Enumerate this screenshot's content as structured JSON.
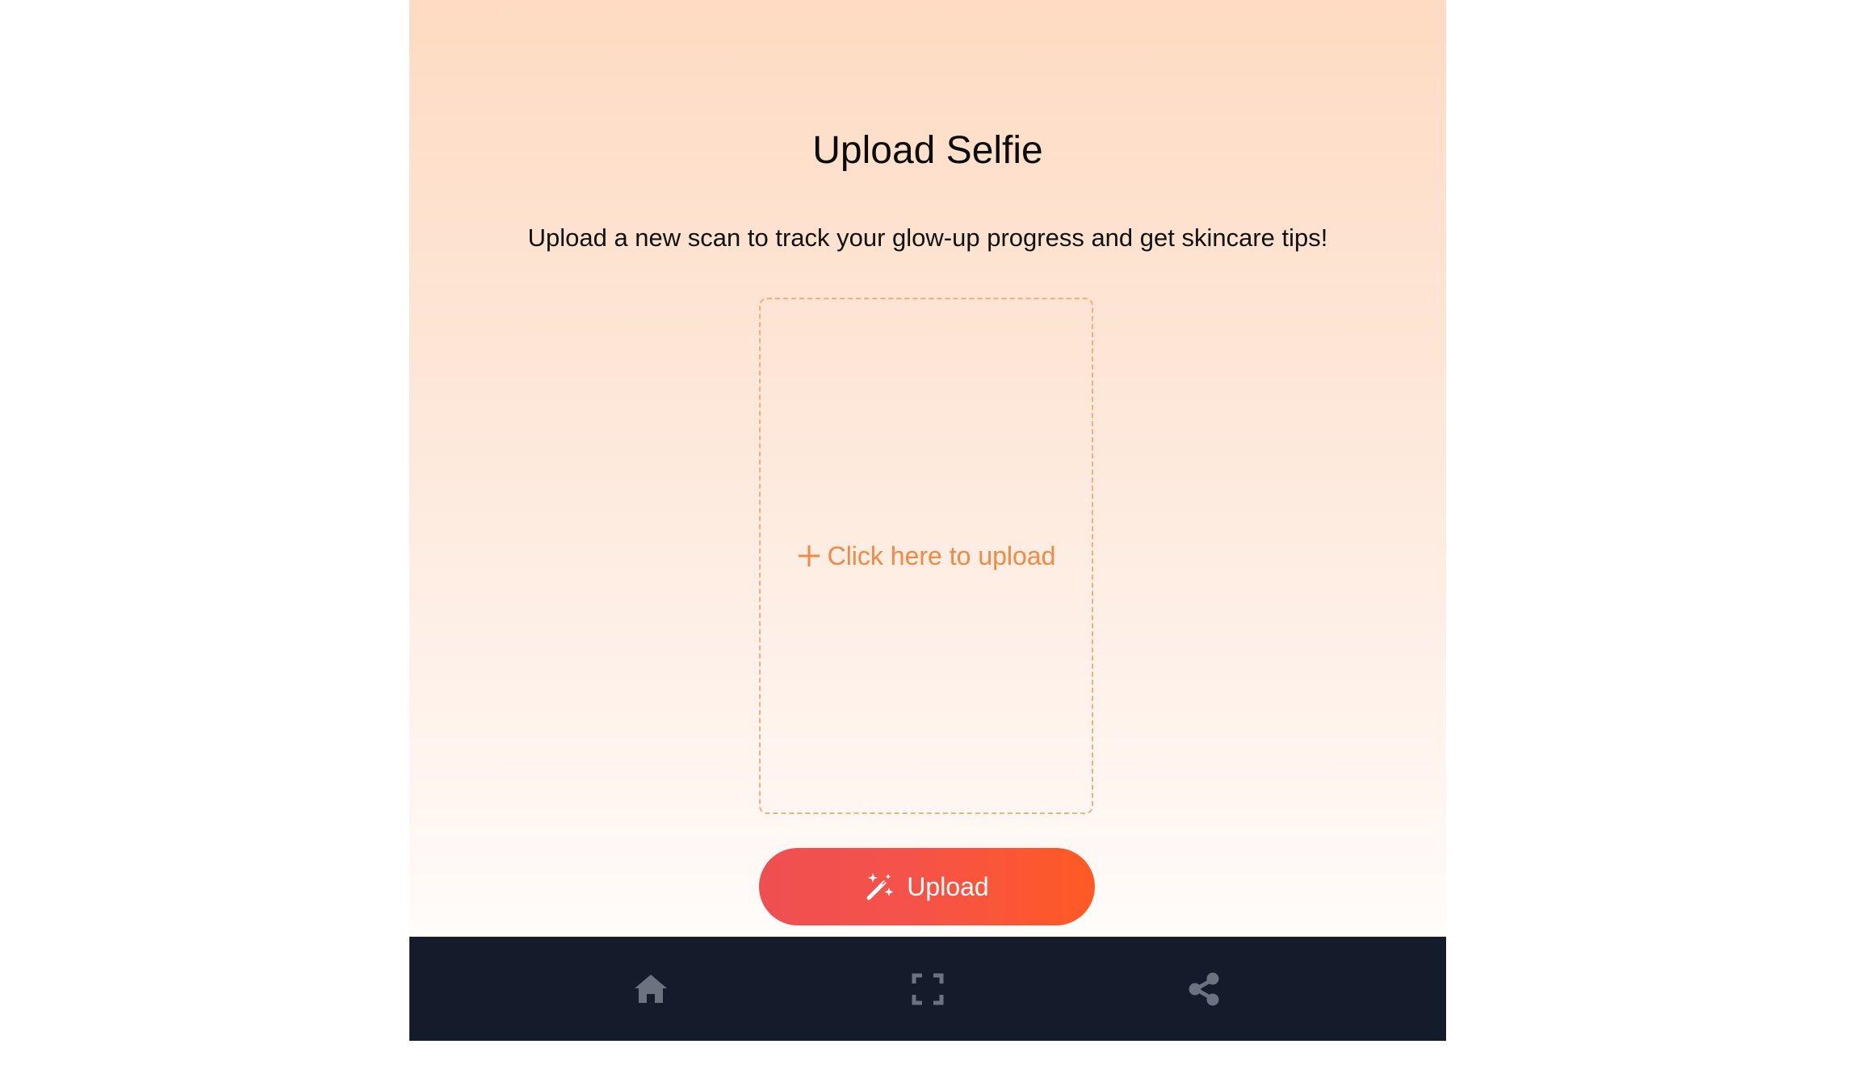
{
  "page": {
    "title": "Upload Selfie",
    "subtitle": "Upload a new scan to track your glow-up progress and get skincare tips!"
  },
  "dropzone": {
    "icon": "plus-icon",
    "label": "Click here to upload"
  },
  "upload_button": {
    "icon": "magic-wand-icon",
    "label": "Upload"
  },
  "bottom_nav": {
    "items": [
      {
        "icon": "home-icon"
      },
      {
        "icon": "scan-icon"
      },
      {
        "icon": "share-icon"
      }
    ]
  },
  "colors": {
    "accent": "#f08a44",
    "button_gradient_start": "#ef4f50",
    "button_gradient_end": "#ff5a24",
    "nav_background": "#141b2b",
    "nav_icon": "#6b7280"
  }
}
